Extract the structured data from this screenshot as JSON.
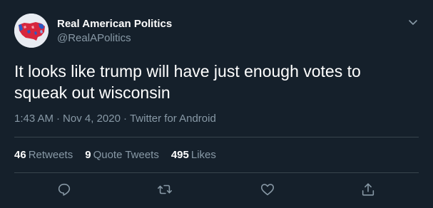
{
  "author": {
    "display_name": "Real American Politics",
    "handle": "@RealAPolitics",
    "avatar_icon": "us-map-avatar-icon"
  },
  "tweet": {
    "text": "It looks like trump will have just enough votes to squeak out wisconsin",
    "time": "1:43 AM",
    "date": "Nov 4, 2020",
    "source": "Twitter for Android"
  },
  "stats": {
    "retweets_count": "46",
    "retweets_label": "Retweets",
    "quote_count": "9",
    "quote_label": "Quote Tweets",
    "likes_count": "495",
    "likes_label": "Likes"
  },
  "actions": [
    "reply-icon",
    "retweet-icon",
    "like-icon",
    "share-icon"
  ],
  "colors": {
    "background": "#15202b",
    "primary_text": "#ffffff",
    "secondary_text": "#8899a6",
    "divider": "#38444d"
  }
}
